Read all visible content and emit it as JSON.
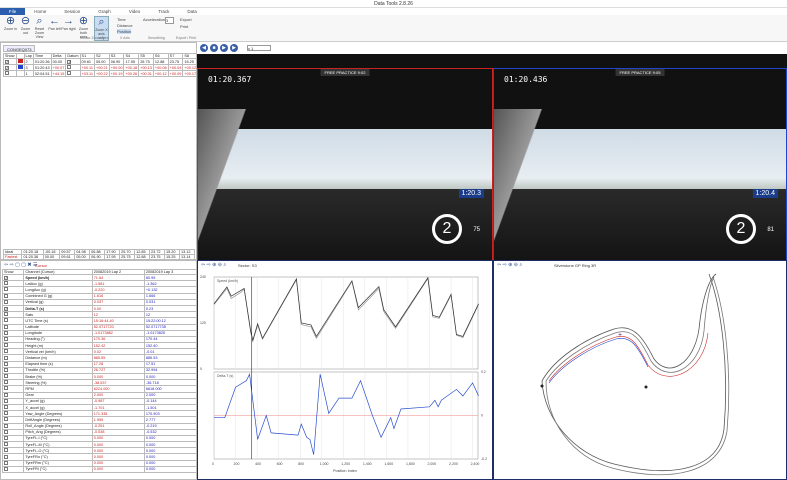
{
  "app": {
    "title": "Data Tools 2.8.26"
  },
  "tabs": [
    "File",
    "Home",
    "Session",
    "Graph",
    "Video",
    "Track",
    "Data"
  ],
  "ribbon": {
    "buttons": [
      {
        "label": "Zoom in",
        "icon": "zoom-in-icon",
        "glyph": "⊕"
      },
      {
        "label": "Zoom out",
        "icon": "zoom-out-icon",
        "glyph": "⊖"
      },
      {
        "label": "Reset Zoom View",
        "icon": "reset-zoom-icon",
        "glyph": "⌕"
      },
      {
        "label": "Pan left",
        "icon": "arrow-left-icon",
        "glyph": "←"
      },
      {
        "label": "Pan right",
        "icon": "arrow-right-icon",
        "glyph": "→"
      },
      {
        "label": "Zoom both axes",
        "icon": "zoom-both-icon",
        "glyph": "⊕"
      },
      {
        "label": "Zoom X axis only",
        "icon": "zoom-x-icon",
        "glyph": "⌕"
      }
    ],
    "xaxis": [
      "Time",
      "Distance",
      "Position"
    ],
    "acceleration_label": "Acceleration:",
    "acceleration_value": "3",
    "export": "Export",
    "print": "Print",
    "groups": [
      "Mouse Zoom Area",
      "X Axis",
      "Smoothing",
      "Export / Print"
    ]
  },
  "laps": {
    "doc_tab": "CONGEQ073",
    "headers": [
      "Show",
      "",
      "Lap",
      "Time",
      "Delta",
      "Datum",
      "S1",
      "S2",
      "S3",
      "S4",
      "S5",
      "S6",
      "S7",
      "S8",
      "S9"
    ],
    "rows": [
      {
        "show": "✓",
        "color": "#cc2222",
        "lap": "2",
        "time": "01:20.36",
        "delta": "00.00",
        "datum": "✓",
        "sectors": [
          "09.61",
          "05.00",
          "06.90",
          "17.95",
          "25.75",
          "12.88",
          "23.75",
          "15.25",
          "13.14"
        ]
      },
      {
        "show": "✓",
        "color": "#2244cc",
        "lap": "3",
        "time": "01:20.43",
        "delta": "+00.07",
        "datum": "",
        "sectors": [
          "+00.11",
          "+00.21",
          "+00.00",
          "+00.18",
          "+00.13",
          "+00.08",
          "+00.04",
          "+00.12",
          "+00.05"
        ]
      },
      {
        "show": "",
        "color": "#ffffff",
        "lap": "1",
        "time": "02:04.51",
        "delta": "+44.15",
        "datum": "",
        "sectors": [
          "+03.11",
          "+00.22",
          "+00.19",
          "+00.26",
          "+00.31",
          "+00.12",
          "+00.09",
          "+00.17",
          "+00.11"
        ]
      }
    ],
    "summary": [
      {
        "label": "Ideal",
        "time": "01:20.18",
        "delta": "-00.18",
        "sectors": [
          "09.57",
          "04.98",
          "06.88",
          "17.90",
          "25.70",
          "12.85",
          "23.72",
          "15.20",
          "13.12"
        ]
      },
      {
        "label": "Fastest",
        "time": "01:20.36",
        "delta": "00.00",
        "sectors": [
          "09.61",
          "05.00",
          "06.90",
          "17.95",
          "25.75",
          "12.88",
          "23.75",
          "15.25",
          "13.14"
        ]
      }
    ]
  },
  "channels": {
    "toolbar_label": "Cursor",
    "headers": [
      "Show",
      "Channel (Cursor)",
      "20082019 Lap 2",
      "20082019 Lap 3"
    ],
    "rows": [
      [
        "✓",
        "Speed (km/h)",
        "71.64",
        "80.95"
      ],
      [
        "",
        "LatAcc (g)",
        "-1.581",
        "-1.362"
      ],
      [
        "",
        "LongAcc (g)",
        "-0.220",
        "+0.132"
      ],
      [
        "",
        "Combined G (g)",
        "1.616",
        "1.666"
      ],
      [
        "",
        "Vertical (g)",
        "0.037",
        "0.031"
      ],
      [
        "✓",
        "Delta-T (s)",
        "0.00",
        "0.23"
      ],
      [
        "",
        "Sats",
        "12",
        "12"
      ],
      [
        "",
        "UTC Time (s)",
        "15:16:44.40",
        "15:22:00.12"
      ],
      [
        "",
        "Latitude",
        "52.0717720",
        "52.0717735"
      ],
      [
        "",
        "Longitude",
        "-1.0173882",
        "-1.0173825"
      ],
      [
        "",
        "Heading (°)",
        "170.36",
        "170.44"
      ],
      [
        "",
        "Height (m)",
        "152.42",
        "152.40"
      ],
      [
        "",
        "Vertical vel (km/h)",
        "0.02",
        "-0.01"
      ],
      [
        "",
        "Distance (m)",
        "885.55",
        "885.53"
      ],
      [
        "",
        "Elapsed time (s)",
        "17.28",
        "17.51"
      ],
      [
        "",
        "Throttle (%)",
        "26.727",
        "32.994"
      ],
      [
        "",
        "Brake (%)",
        "0.000",
        "0.000"
      ],
      [
        "",
        "Steering (%)",
        "-38.537",
        "-36.718"
      ],
      [
        "",
        "RPM",
        "6224.000",
        "6618.000"
      ],
      [
        "",
        "Gear",
        "2.000",
        "2.000"
      ],
      [
        "",
        "Y_accel (g)",
        "-0.987",
        "-0.144"
      ],
      [
        "",
        "X_accel (g)",
        "-1.701",
        "-1.501"
      ],
      [
        "",
        "Yaw_Angle (Degrees)",
        "171.335",
        "170.903"
      ],
      [
        "",
        "DriftAngle (Degrees)",
        "1.955",
        "2.777"
      ],
      [
        "",
        "Roll_Angle (Degrees)",
        "-0.251",
        "-0.219"
      ],
      [
        "",
        "Pitch_Ang (Degrees)",
        "-0.538",
        "-0.532"
      ],
      [
        "",
        "TyreFL-I (°C)",
        "0.000",
        "0.000"
      ],
      [
        "",
        "TyreFL-M (°C)",
        "0.000",
        "0.000"
      ],
      [
        "",
        "TyreFL-O (°C)",
        "0.000",
        "0.000"
      ],
      [
        "",
        "TyreFRo (°C)",
        "0.000",
        "0.000"
      ],
      [
        "",
        "TyreFRm (°C)",
        "0.000",
        "0.000"
      ],
      [
        "",
        "TyreFRi (°C)",
        "0.000",
        "0.000"
      ]
    ]
  },
  "video": {
    "speed_select": "x 1",
    "left": {
      "timer": "01:20.367",
      "tag": "FREE PRACTICE  9:02",
      "laptime": "1:20.3",
      "gear": "2",
      "speed": "75"
    },
    "right": {
      "timer": "01:20.436",
      "tag": "FREE PRACTICE  9:05",
      "laptime": "1:20.4",
      "gear": "2",
      "speed": "81"
    },
    "colors": {
      "left": "#cc2222",
      "right": "#2244cc"
    }
  },
  "chart_data": {
    "type": "line",
    "title": "Sector: S3",
    "xlabel": "Position Index",
    "xlim": [
      0,
      2450
    ],
    "xticks": [
      0,
      200,
      400,
      600,
      800,
      "1,000",
      "1,200",
      "1,400",
      "1,600",
      "1,800",
      "2,000",
      "2,200",
      "2,400"
    ],
    "cursor_x": 350,
    "panels": [
      {
        "label": "Speed (km/h)",
        "ylim": [
          0,
          240
        ],
        "yticks": [
          "0",
          "120",
          "240"
        ],
        "series": [
          {
            "name": "Lap 2",
            "color": "#333333",
            "x": [
              0,
              120,
              160,
              250,
              280,
              340,
              360,
              405,
              450,
              765,
              810,
              900,
              950,
              1280,
              1340,
              1530,
              1575,
              1685,
              1985,
              2030,
              2090,
              2200,
              2250,
              2310,
              2455
            ],
            "y": [
              170,
              214,
              190,
              205,
              210,
              100,
              75,
              118,
              80,
              235,
              120,
              115,
              85,
              230,
              160,
              215,
              155,
              110,
              238,
              140,
              135,
              195,
              90,
              85,
              170
            ]
          },
          {
            "name": "Lap 3",
            "color": "#999999",
            "x": [
              0,
              120,
              160,
              250,
              280,
              340,
              360,
              405,
              450,
              765,
              810,
              900,
              950,
              1280,
              1340,
              1530,
              1575,
              1685,
              1985,
              2030,
              2090,
              2200,
              2250,
              2310,
              2455
            ],
            "y": [
              168,
              210,
              184,
              200,
              208,
              96,
              72,
              114,
              78,
              233,
              116,
              110,
              80,
              228,
              154,
              210,
              150,
              106,
              236,
              136,
              132,
              192,
              88,
              82,
              168
            ]
          }
        ]
      },
      {
        "label": "Delta-T (s)",
        "ylim": [
          -0.2,
          0.2
        ],
        "yticks": [
          "-0.2",
          "0",
          "0.2"
        ],
        "series": [
          {
            "name": "Delta-T",
            "color": "#2a4fcf",
            "x": [
              0,
              100,
              200,
              300,
              330,
              405,
              485,
              530,
              780,
              810,
              860,
              890,
              925,
              985,
              1065,
              1160,
              1280,
              1360,
              1470,
              1550,
              1640,
              1670,
              1735,
              2000,
              2050,
              2080,
              2110,
              2250,
              2310,
              2400,
              2455
            ],
            "y": [
              -0.01,
              -0.01,
              0.13,
              0.16,
              0.19,
              -0.11,
              0,
              -0.08,
              -0.09,
              -0.04,
              -0.1,
              -0.11,
              -0.18,
              0.19,
              0.01,
              0.08,
              0.08,
              0.16,
              0,
              -0.1,
              -0.01,
              -0.06,
              0.03,
              0.04,
              0.07,
              0.04,
              0.07,
              0.12,
              0.09,
              0.15,
              0.09
            ]
          }
        ]
      }
    ]
  },
  "map": {
    "title": "Silverstone GP Ring 3R"
  }
}
